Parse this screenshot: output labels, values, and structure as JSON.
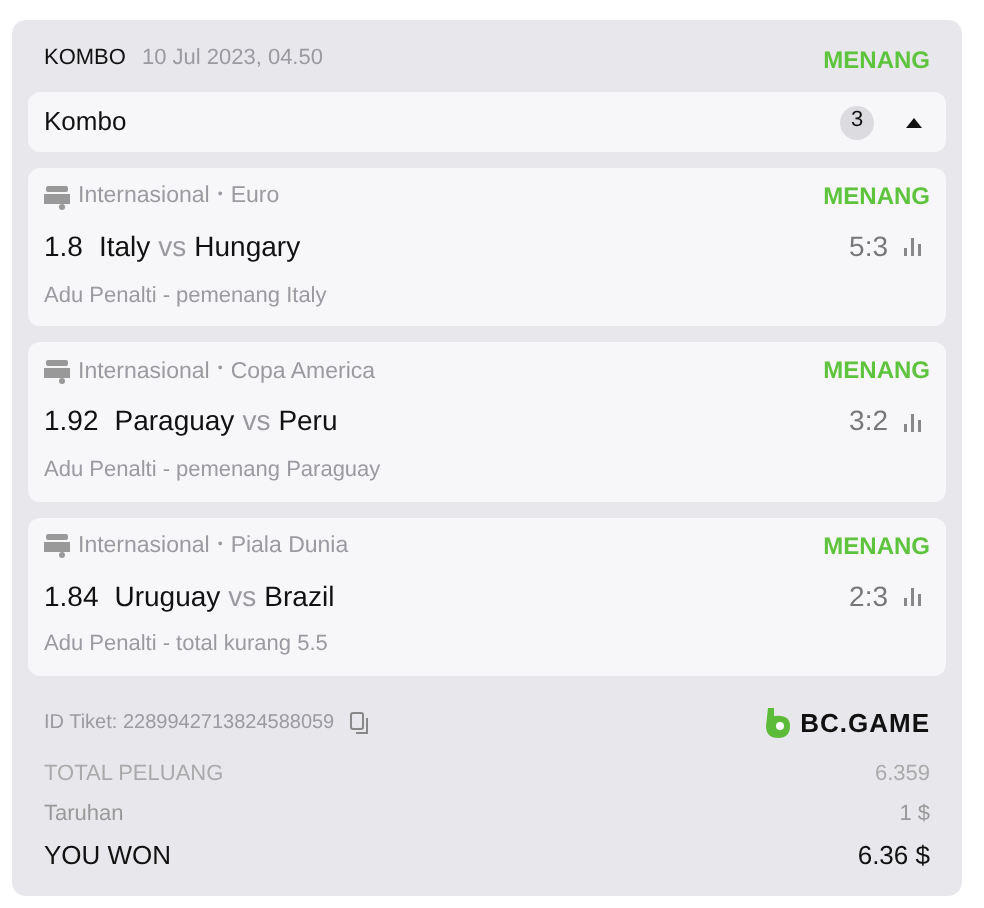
{
  "header": {
    "type": "KOMBO",
    "date": "10 Jul 2023, 04.50",
    "status": "MENANG"
  },
  "combo": {
    "title": "Kombo",
    "count": "3",
    "expanded": true
  },
  "bets": [
    {
      "league": "Internasional",
      "sep": "•",
      "tournament": "Euro",
      "status": "MENANG",
      "odds": "1.8",
      "home": "Italy",
      "vs": "vs",
      "away": "Hungary",
      "score": "5:3",
      "market": "Adu Penalti - pemenang Italy"
    },
    {
      "league": "Internasional",
      "sep": "•",
      "tournament": "Copa America",
      "status": "MENANG",
      "odds": "1.92",
      "home": "Paraguay",
      "vs": "vs",
      "away": "Peru",
      "score": "3:2",
      "market": "Adu Penalti - pemenang Paraguay"
    },
    {
      "league": "Internasional",
      "sep": "•",
      "tournament": "Piala Dunia",
      "status": "MENANG",
      "odds": "1.84",
      "home": "Uruguay",
      "vs": "vs",
      "away": "Brazil",
      "score": "2:3",
      "market": "Adu Penalti - total kurang 5.5"
    }
  ],
  "ticket": {
    "id": "ID Tiket: 2289942713824588059",
    "brand": "BC.GAME"
  },
  "totals": [
    {
      "kind": "muted",
      "label": "TOTAL PELUANG",
      "value": "6.359"
    },
    {
      "kind": "normal",
      "label": "Taruhan",
      "value": "1 $"
    },
    {
      "kind": "strong",
      "label": "YOU WON",
      "value": "6.36 $"
    }
  ]
}
